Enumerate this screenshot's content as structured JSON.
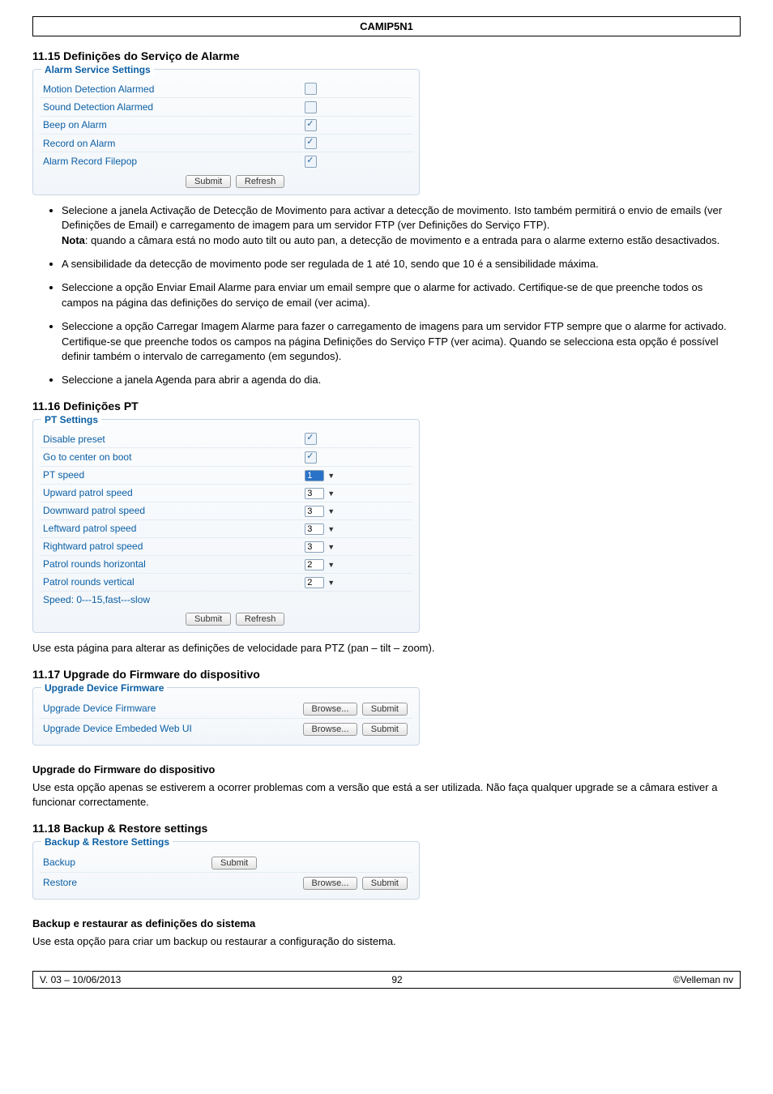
{
  "header": {
    "title": "CAMIP5N1"
  },
  "sec_11_15": {
    "title": "11.15 Definições do Serviço de Alarme",
    "panel_legend": "Alarm Service Settings",
    "rows": [
      {
        "label": "Motion Detection Alarmed",
        "type": "chk",
        "checked": false
      },
      {
        "label": "Sound Detection Alarmed",
        "type": "chk",
        "checked": false
      },
      {
        "label": "Beep on Alarm",
        "type": "chk",
        "checked": true
      },
      {
        "label": "Record on Alarm",
        "type": "chk",
        "checked": true
      },
      {
        "label": "Alarm Record Filepop",
        "type": "chk",
        "checked": true
      }
    ],
    "buttons": {
      "submit": "Submit",
      "refresh": "Refresh"
    },
    "bullets": {
      "b1": "Selecione a janela Activação de Detecção de Movimento para activar a detecção de movimento. Isto também permitirá o envio de emails (ver Definições de Email) e carregamento de imagem para um servidor FTP (ver Definições do Serviço FTP).",
      "b1_nota_label": "Nota",
      "b1_nota": ": quando a câmara está no modo auto tilt ou auto pan, a detecção de movimento e a entrada para o alarme externo estão desactivados.",
      "b2": "A sensibilidade da detecção de movimento pode ser regulada de 1 até 10, sendo que 10 é a sensibilidade máxima.",
      "b3": "Seleccione a opção Enviar Email Alarme para enviar um email sempre que o alarme for activado. Certifique-se de que preenche todos os campos na página das definições do serviço de email  (ver acima).",
      "b4": "Seleccione a opção Carregar Imagem Alarme para fazer o carregamento de imagens para um servidor FTP sempre que o alarme for activado.",
      "b4_cont": "Certifique-se que preenche todos os campos na página Definições do Serviço FTP (ver acima). Quando se selecciona esta opção é possível definir também o intervalo de carregamento (em segundos).",
      "b5": "Seleccione a janela Agenda para abrir a agenda do dia."
    }
  },
  "sec_11_16": {
    "title": "11.16 Definições PT",
    "panel_legend": "PT Settings",
    "rows": [
      {
        "label": "Disable preset",
        "type": "chk",
        "checked": true
      },
      {
        "label": "Go to center on boot",
        "type": "chk",
        "checked": true
      },
      {
        "label": "PT speed",
        "type": "sel",
        "value": "1",
        "hl": true
      },
      {
        "label": "Upward patrol speed",
        "type": "sel",
        "value": "3"
      },
      {
        "label": "Downward patrol speed",
        "type": "sel",
        "value": "3"
      },
      {
        "label": "Leftward patrol speed",
        "type": "sel",
        "value": "3"
      },
      {
        "label": "Rightward patrol speed",
        "type": "sel",
        "value": "3"
      },
      {
        "label": "Patrol rounds horizontal",
        "type": "sel",
        "value": "2"
      },
      {
        "label": "Patrol rounds vertical",
        "type": "sel",
        "value": "2"
      }
    ],
    "footer_row": "Speed: 0---15,fast---slow",
    "buttons": {
      "submit": "Submit",
      "refresh": "Refresh"
    },
    "para": "Use esta página para alterar as definições de velocidade para PTZ (pan – tilt – zoom)."
  },
  "sec_11_17": {
    "title": "11.17 Upgrade do Firmware do dispositivo",
    "panel_legend": "Upgrade Device Firmware",
    "rows": [
      {
        "label": "Upgrade Device Firmware",
        "browse": "Browse...",
        "submit": "Submit"
      },
      {
        "label": "Upgrade Device Embeded Web UI",
        "browse": "Browse...",
        "submit": "Submit"
      }
    ],
    "sub_title": "Upgrade do Firmware do dispositivo",
    "para": "Use esta opção apenas se estiverem a ocorrer problemas com a versão que está a ser utilizada. Não faça qualquer upgrade se a câmara estiver a funcionar correctamente."
  },
  "sec_11_18": {
    "title": "11.18 Backup & Restore settings",
    "panel_legend": "Backup & Restore Settings",
    "backup": {
      "label": "Backup",
      "submit": "Submit"
    },
    "restore": {
      "label": "Restore",
      "browse": "Browse...",
      "submit": "Submit"
    },
    "sub_title": "Backup e restaurar as definições do sistema",
    "para": "Use esta opção para criar um backup ou restaurar a configuração do sistema."
  },
  "footer": {
    "left": "V. 03 – 10/06/2013",
    "center": "92",
    "right": "©Velleman nv"
  }
}
